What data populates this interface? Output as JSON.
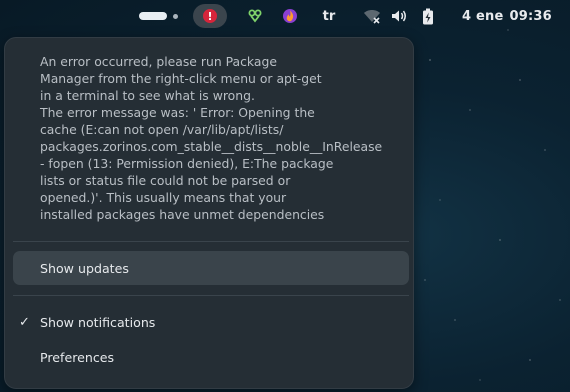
{
  "topbar": {
    "error_glyph": "!",
    "keyboard_layout": "tr",
    "clock": {
      "date": "4 ene",
      "time": "09:36"
    }
  },
  "popover": {
    "message": "An error occurred, please run Package\nManager from the right-click menu or apt-get\nin a terminal to see what is wrong.\nThe error message was: ' Error: Opening the\ncache (E:can not open /var/lib/apt/lists/\npackages.zorinos.com_stable__dists__noble__InRelease\n- fopen (13: Permission denied), E:The package\nlists or status file could not be parsed or\nopened.)'. This usually means that your\ninstalled packages have unmet dependencies",
    "items": [
      {
        "label": "Show updates",
        "highlighted": true
      },
      {
        "label": "Show notifications",
        "checked": true,
        "check_glyph": "✓"
      },
      {
        "label": "Preferences"
      }
    ]
  },
  "colors": {
    "popover_bg": "#252e35",
    "error_red": "#d6253b",
    "highlight": "#3a444b"
  }
}
